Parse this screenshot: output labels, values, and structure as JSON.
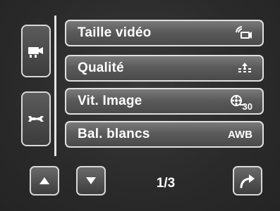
{
  "menu": {
    "items": [
      {
        "label": "Taille vidéo",
        "value": ""
      },
      {
        "label": "Qualité",
        "value": ""
      },
      {
        "label": "Vit. Image",
        "value": "30"
      },
      {
        "label": "Bal. blancs",
        "value": "AWB"
      }
    ]
  },
  "tabs": {
    "video_icon": "video-camera-icon",
    "setup_icon": "wrench-icon"
  },
  "nav": {
    "up_icon": "up-arrow-icon",
    "down_icon": "down-arrow-icon",
    "exit_icon": "curved-arrow-icon",
    "page": "1/3"
  },
  "colors": {
    "background": "#2b2b2b",
    "border": "#e0e0e0",
    "text": "#ffffff"
  }
}
